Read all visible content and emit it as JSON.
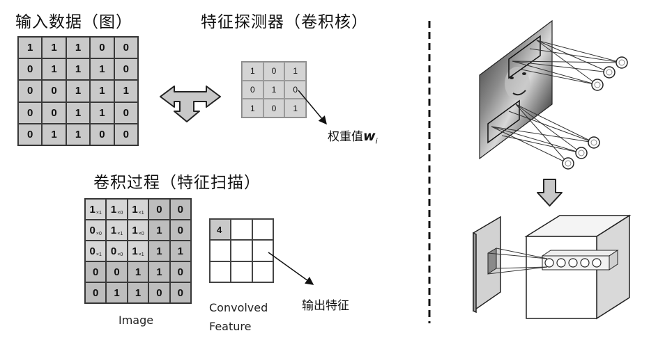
{
  "titles": {
    "input": "输入数据（图）",
    "kernel": "特征探测器（卷积核）",
    "process": "卷积过程（特征扫描）"
  },
  "input_matrix": [
    [
      "1",
      "1",
      "1",
      "0",
      "0"
    ],
    [
      "0",
      "1",
      "1",
      "1",
      "0"
    ],
    [
      "0",
      "0",
      "1",
      "1",
      "1"
    ],
    [
      "0",
      "0",
      "1",
      "1",
      "0"
    ],
    [
      "0",
      "1",
      "1",
      "0",
      "0"
    ]
  ],
  "kernel_matrix": [
    [
      "1",
      "0",
      "1"
    ],
    [
      "0",
      "1",
      "0"
    ],
    [
      "1",
      "0",
      "1"
    ]
  ],
  "kernel_label": {
    "text": "权重值",
    "symbol": "w",
    "subscript": "i"
  },
  "image_matrix": [
    [
      {
        "v": "1",
        "s": "×1"
      },
      {
        "v": "1",
        "s": "×0"
      },
      {
        "v": "1",
        "s": "×1"
      },
      {
        "v": "0",
        "s": ""
      },
      {
        "v": "0",
        "s": ""
      }
    ],
    [
      {
        "v": "0",
        "s": "×0"
      },
      {
        "v": "1",
        "s": "×1"
      },
      {
        "v": "1",
        "s": "×0"
      },
      {
        "v": "1",
        "s": ""
      },
      {
        "v": "0",
        "s": ""
      }
    ],
    [
      {
        "v": "0",
        "s": "×1"
      },
      {
        "v": "0",
        "s": "×0"
      },
      {
        "v": "1",
        "s": "×1"
      },
      {
        "v": "1",
        "s": ""
      },
      {
        "v": "1",
        "s": ""
      }
    ],
    [
      {
        "v": "0",
        "s": ""
      },
      {
        "v": "0",
        "s": ""
      },
      {
        "v": "1",
        "s": ""
      },
      {
        "v": "1",
        "s": ""
      },
      {
        "v": "0",
        "s": ""
      }
    ],
    [
      {
        "v": "0",
        "s": ""
      },
      {
        "v": "1",
        "s": ""
      },
      {
        "v": "1",
        "s": ""
      },
      {
        "v": "0",
        "s": ""
      },
      {
        "v": "0",
        "s": ""
      }
    ]
  ],
  "feature_matrix": [
    [
      "4",
      "",
      ""
    ],
    [
      "",
      "",
      ""
    ],
    [
      "",
      "",
      ""
    ]
  ],
  "captions": {
    "image": "Image",
    "feature_line1": "Convolved",
    "feature_line2": "Feature",
    "output": "输出特征"
  }
}
